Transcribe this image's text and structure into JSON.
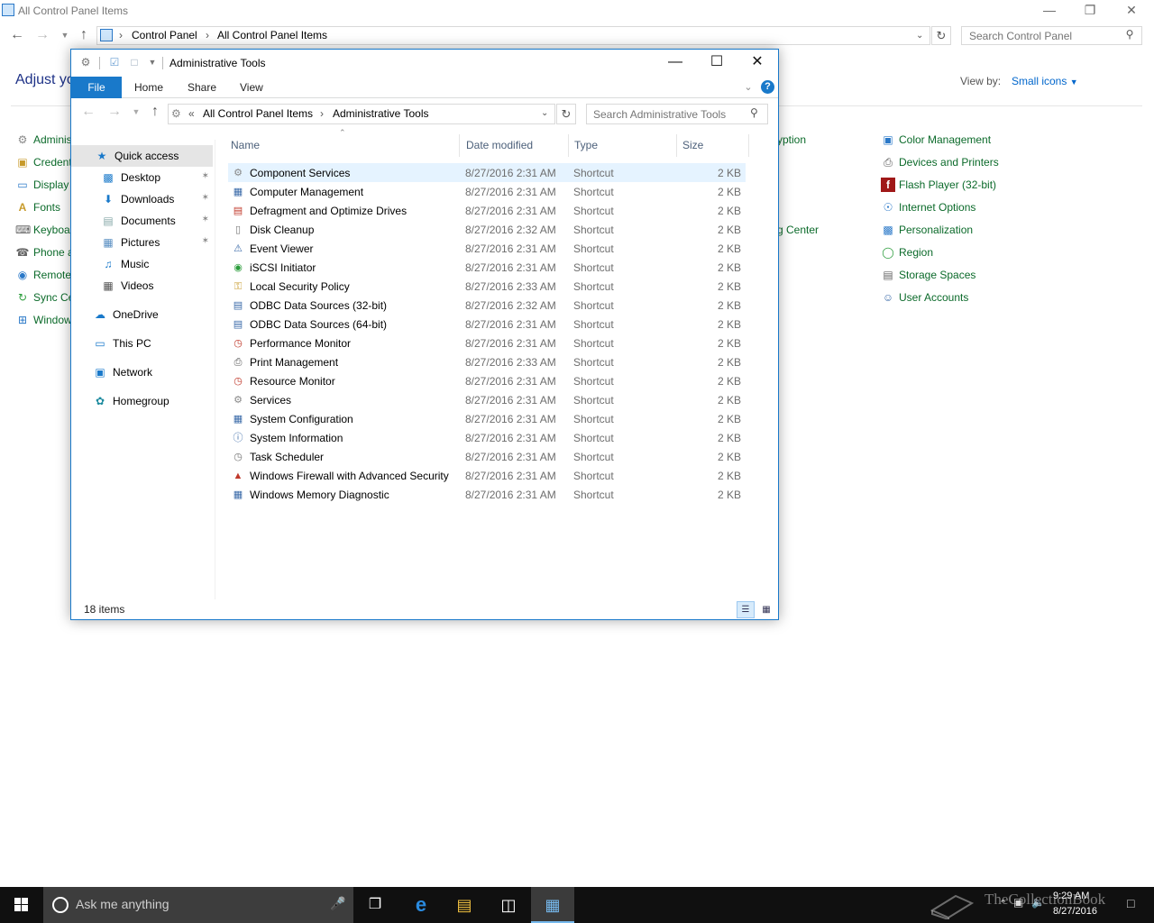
{
  "control_panel": {
    "window_title": "All Control Panel Items",
    "breadcrumb": [
      "Control Panel",
      "All Control Panel Items"
    ],
    "search_placeholder": "Search Control Panel",
    "heading": "Adjust yo",
    "view_by_label": "View by:",
    "view_by_value": "Small icons",
    "items_left": [
      {
        "label": "Adminis",
        "icon": "admin-tools-icon"
      },
      {
        "label": "Credent",
        "icon": "credential-icon"
      },
      {
        "label": "Display",
        "icon": "display-icon"
      },
      {
        "label": "Fonts",
        "icon": "fonts-icon"
      },
      {
        "label": "Keyboa",
        "icon": "keyboard-icon"
      },
      {
        "label": "Phone a",
        "icon": "phone-icon"
      },
      {
        "label": "Remote",
        "icon": "remote-icon"
      },
      {
        "label": "Sync Ce",
        "icon": "sync-icon"
      },
      {
        "label": "Window",
        "icon": "windows-icon"
      }
    ],
    "items_mid": [
      {
        "label": "yption",
        "icon": "bitlocker-icon"
      },
      {
        "label": "g Center",
        "icon": "network-center-icon"
      }
    ],
    "items_right": [
      {
        "label": "Color Management",
        "icon": "color-management-icon"
      },
      {
        "label": "Devices and Printers",
        "icon": "printer-icon"
      },
      {
        "label": "Flash Player (32-bit)",
        "icon": "flash-icon"
      },
      {
        "label": "Internet Options",
        "icon": "internet-icon"
      },
      {
        "label": "Personalization",
        "icon": "personalization-icon"
      },
      {
        "label": "Region",
        "icon": "region-icon"
      },
      {
        "label": "Storage Spaces",
        "icon": "storage-icon"
      },
      {
        "label": "User Accounts",
        "icon": "user-accounts-icon"
      }
    ]
  },
  "explorer": {
    "title": "Administrative Tools",
    "ribbon_tabs": [
      "File",
      "Home",
      "Share",
      "View"
    ],
    "breadcrumb_prefix": "«",
    "breadcrumb": [
      "All Control Panel Items",
      "Administrative Tools"
    ],
    "search_placeholder": "Search Administrative Tools",
    "nav_pane": [
      {
        "label": "Quick access",
        "icon": "star-icon",
        "pinned": false
      },
      {
        "label": "Desktop",
        "icon": "desktop-icon",
        "pinned": true
      },
      {
        "label": "Downloads",
        "icon": "download-icon",
        "pinned": true
      },
      {
        "label": "Documents",
        "icon": "document-icon",
        "pinned": true
      },
      {
        "label": "Pictures",
        "icon": "pictures-icon",
        "pinned": true
      },
      {
        "label": "Music",
        "icon": "music-icon",
        "pinned": false
      },
      {
        "label": "Videos",
        "icon": "videos-icon",
        "pinned": false
      },
      {
        "label": "OneDrive",
        "icon": "cloud-icon",
        "pinned": false
      },
      {
        "label": "This PC",
        "icon": "computer-icon",
        "pinned": false
      },
      {
        "label": "Network",
        "icon": "network-icon",
        "pinned": false
      },
      {
        "label": "Homegroup",
        "icon": "homegroup-icon",
        "pinned": false
      }
    ],
    "columns": [
      "Name",
      "Date modified",
      "Type",
      "Size"
    ],
    "files": [
      {
        "name": "Component Services",
        "date": "8/27/2016 2:31 AM",
        "type": "Shortcut",
        "size": "2 KB"
      },
      {
        "name": "Computer Management",
        "date": "8/27/2016 2:31 AM",
        "type": "Shortcut",
        "size": "2 KB"
      },
      {
        "name": "Defragment and Optimize Drives",
        "date": "8/27/2016 2:31 AM",
        "type": "Shortcut",
        "size": "2 KB"
      },
      {
        "name": "Disk Cleanup",
        "date": "8/27/2016 2:32 AM",
        "type": "Shortcut",
        "size": "2 KB"
      },
      {
        "name": "Event Viewer",
        "date": "8/27/2016 2:31 AM",
        "type": "Shortcut",
        "size": "2 KB"
      },
      {
        "name": "iSCSI Initiator",
        "date": "8/27/2016 2:31 AM",
        "type": "Shortcut",
        "size": "2 KB"
      },
      {
        "name": "Local Security Policy",
        "date": "8/27/2016 2:33 AM",
        "type": "Shortcut",
        "size": "2 KB"
      },
      {
        "name": "ODBC Data Sources (32-bit)",
        "date": "8/27/2016 2:32 AM",
        "type": "Shortcut",
        "size": "2 KB"
      },
      {
        "name": "ODBC Data Sources (64-bit)",
        "date": "8/27/2016 2:31 AM",
        "type": "Shortcut",
        "size": "2 KB"
      },
      {
        "name": "Performance Monitor",
        "date": "8/27/2016 2:31 AM",
        "type": "Shortcut",
        "size": "2 KB"
      },
      {
        "name": "Print Management",
        "date": "8/27/2016 2:33 AM",
        "type": "Shortcut",
        "size": "2 KB"
      },
      {
        "name": "Resource Monitor",
        "date": "8/27/2016 2:31 AM",
        "type": "Shortcut",
        "size": "2 KB"
      },
      {
        "name": "Services",
        "date": "8/27/2016 2:31 AM",
        "type": "Shortcut",
        "size": "2 KB"
      },
      {
        "name": "System Configuration",
        "date": "8/27/2016 2:31 AM",
        "type": "Shortcut",
        "size": "2 KB"
      },
      {
        "name": "System Information",
        "date": "8/27/2016 2:31 AM",
        "type": "Shortcut",
        "size": "2 KB"
      },
      {
        "name": "Task Scheduler",
        "date": "8/27/2016 2:31 AM",
        "type": "Shortcut",
        "size": "2 KB"
      },
      {
        "name": "Windows Firewall with Advanced Security",
        "date": "8/27/2016 2:31 AM",
        "type": "Shortcut",
        "size": "2 KB"
      },
      {
        "name": "Windows Memory Diagnostic",
        "date": "8/27/2016 2:31 AM",
        "type": "Shortcut",
        "size": "2 KB"
      }
    ],
    "item_count": "18 items"
  },
  "taskbar": {
    "search_text": "Ask me anything",
    "time": "9:29 AM",
    "date": "8/27/2016",
    "watermark": "TheCollectionBook",
    "apps": [
      "task-view-icon",
      "edge-icon",
      "file-explorer-icon",
      "store-icon",
      "control-panel-icon"
    ]
  },
  "colors": {
    "accent": "#1979ca",
    "link": "#0066cc",
    "cp_item_text": "#0b6a2a",
    "selection": "#e5f3ff",
    "taskbar": "#101010"
  }
}
